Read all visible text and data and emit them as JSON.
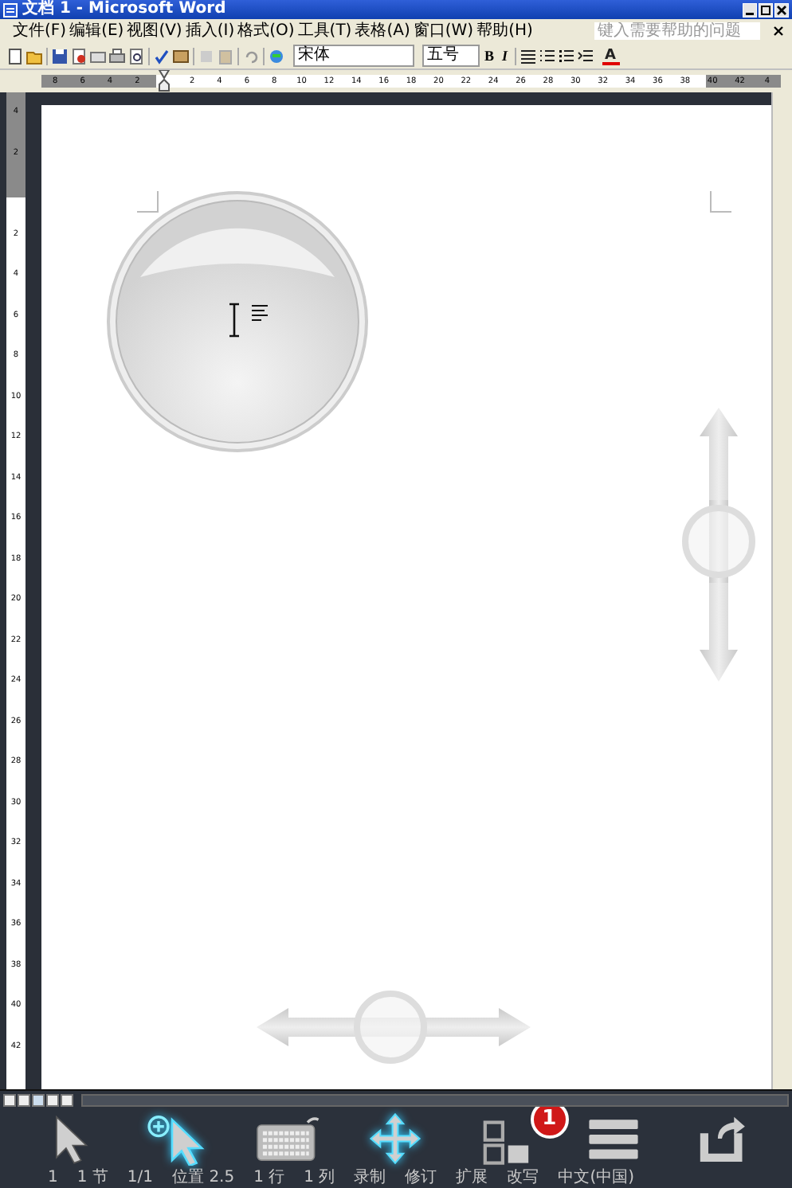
{
  "window": {
    "title": "文档 1 - Microsoft Word"
  },
  "menu": [
    "文件(F)",
    "编辑(E)",
    "视图(V)",
    "插入(I)",
    "格式(O)",
    "工具(T)",
    "表格(A)",
    "窗口(W)",
    "帮助(H)"
  ],
  "help_search": {
    "placeholder": "键入需要帮助的问题"
  },
  "toolbar": {
    "font": "宋体",
    "size": "五号",
    "bold": "B",
    "italic": "I",
    "font_color": "A"
  },
  "horizontal_ruler": {
    "left_labels": [
      "8",
      "6",
      "4",
      "2"
    ],
    "right_labels": [
      "2",
      "4",
      "6",
      "8",
      "10",
      "12",
      "14",
      "16",
      "18",
      "20",
      "22",
      "24",
      "26",
      "28",
      "30",
      "32",
      "34",
      "36",
      "38",
      "40",
      "42",
      "4"
    ]
  },
  "vertical_ruler": {
    "top_labels": [
      "4",
      "2"
    ],
    "labels": [
      "2",
      "4",
      "6",
      "8",
      "10",
      "12",
      "14",
      "16",
      "18",
      "20",
      "22",
      "24",
      "26",
      "28",
      "30",
      "32",
      "34",
      "36",
      "38",
      "40",
      "42"
    ]
  },
  "status_bar": [
    "1",
    "1 节",
    "1/1",
    "位置 2.5",
    "1 行",
    "1 列",
    "录制",
    "修订",
    "扩展",
    "改写",
    "中文(中国)"
  ],
  "remote_toolbar": [
    {
      "kind": "pointer",
      "active": false
    },
    {
      "kind": "zoom_pointer",
      "active": true
    },
    {
      "kind": "keyboard",
      "active": false
    },
    {
      "kind": "move",
      "active": true
    },
    {
      "kind": "windows",
      "active": false,
      "badge": "1"
    },
    {
      "kind": "menu",
      "active": false
    },
    {
      "kind": "back",
      "active": false
    }
  ]
}
